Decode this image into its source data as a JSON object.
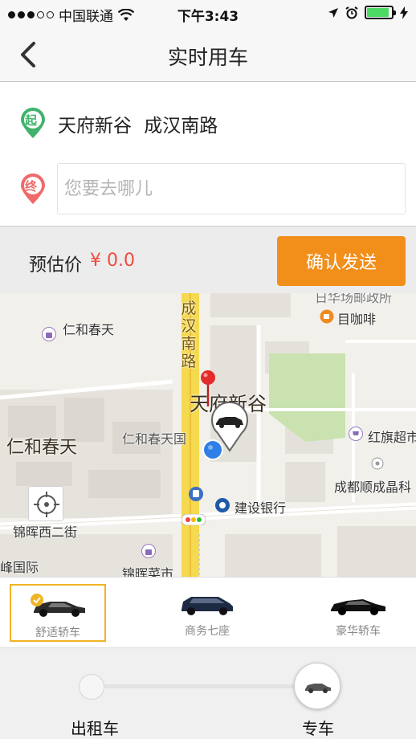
{
  "status_bar": {
    "carrier": "中国联通",
    "time": "下午3:43",
    "battery_level": 0.9,
    "icons": [
      "signal-dots",
      "wifi-icon",
      "location-arrow-icon",
      "alarm-icon",
      "battery-icon",
      "charging-icon"
    ]
  },
  "nav": {
    "title": "实时用车",
    "back_icon": "chevron-left-icon"
  },
  "address": {
    "origin_pin_label": "起",
    "origin_text": "天府新谷 成汉南路",
    "dest_pin_label": "终",
    "dest_placeholder": "您要去哪儿",
    "dest_value": ""
  },
  "price": {
    "label": "预估价",
    "value": "¥ 0.0",
    "confirm_label": "确认发送"
  },
  "map": {
    "labels": {
      "area_renhe_small": "仁和春天",
      "area_renhe_big": "仁和春天",
      "renhe_tianguo": "仁和春天国",
      "road_chenghan": "成汉南路",
      "tianfu_xingu": "天府新谷",
      "coffee": "目咖啡",
      "hongqi": "红旗超市",
      "chengdu_shuncheng": "成都顺成晶科",
      "ccb": "建设银行",
      "jinhui_west": "锦晖西二街",
      "jinhui_market": "锦晖菜市",
      "feng_intl": "峰国际",
      "top_cut_label": "日华场邮政所"
    }
  },
  "cars": [
    {
      "label": "舒适轿车",
      "selected": true
    },
    {
      "label": "商务七座",
      "selected": false
    },
    {
      "label": "豪华轿车",
      "selected": false
    }
  ],
  "services": {
    "left_label": "出租车",
    "right_label": "专车",
    "selected": "专车"
  },
  "colors": {
    "accent_orange": "#f28e1a",
    "price_red": "#f04a3e",
    "origin_green": "#3fb36b",
    "dest_red": "#f06a6a",
    "selected_border": "#f0b323"
  }
}
